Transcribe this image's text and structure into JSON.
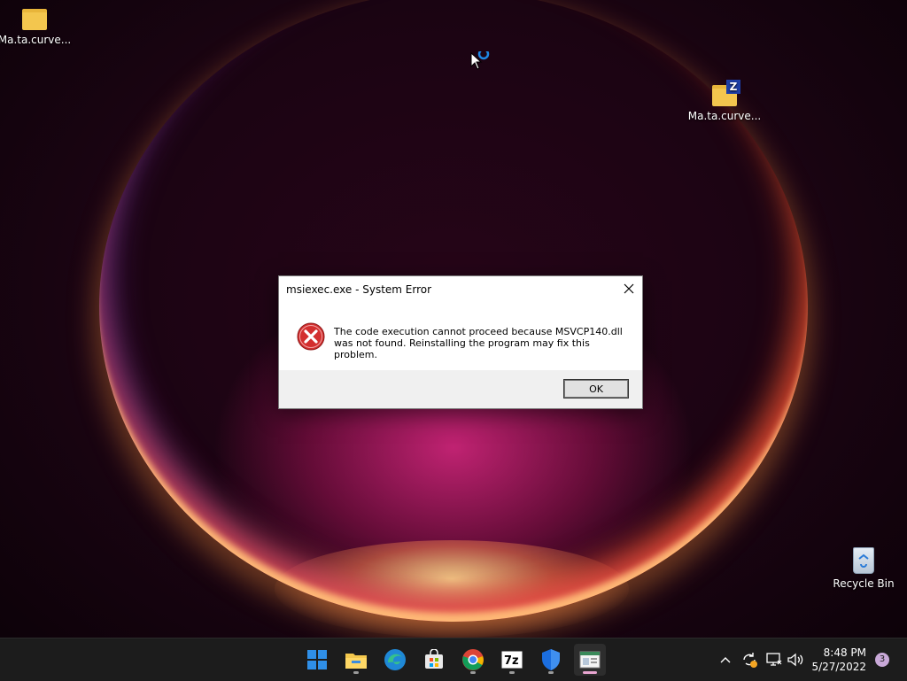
{
  "desktop": {
    "icons": [
      {
        "label": "Ma.ta.curve...",
        "type": "folder"
      },
      {
        "label": "Ma.ta.curve...",
        "type": "zip-folder"
      },
      {
        "label": "Recycle Bin",
        "type": "recycle-bin"
      }
    ]
  },
  "dialog": {
    "title": "msiexec.exe - System Error",
    "message": "The code execution cannot proceed because MSVCP140.dll was not found. Reinstalling the program may fix this problem.",
    "ok_label": "OK"
  },
  "taskbar": {
    "apps": [
      {
        "name": "start-button"
      },
      {
        "name": "file-explorer"
      },
      {
        "name": "edge"
      },
      {
        "name": "microsoft-store"
      },
      {
        "name": "chrome"
      },
      {
        "name": "7-zip"
      },
      {
        "name": "windows-security"
      },
      {
        "name": "active-window"
      }
    ],
    "time": "8:48 PM",
    "date": "5/27/2022",
    "notification_count": "3"
  },
  "colors": {
    "taskbar_bg": "#1c1c1c",
    "dialog_footer": "#f0f0f0",
    "error_red": "#d32f2f"
  }
}
